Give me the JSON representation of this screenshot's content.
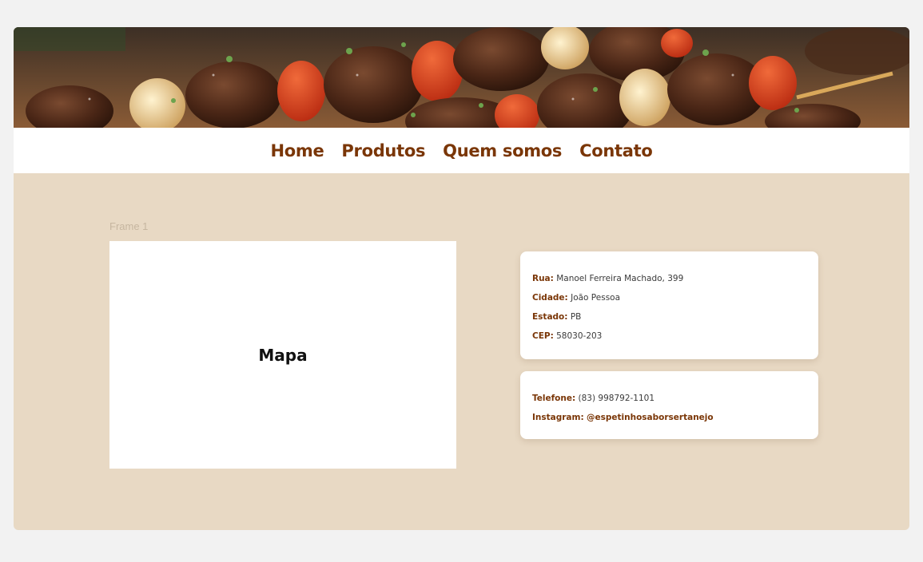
{
  "hero": {
    "image_description_icon": "grilled-skewers-image"
  },
  "nav": {
    "items": [
      {
        "label": "Home"
      },
      {
        "label": "Produtos"
      },
      {
        "label": "Quem somos"
      },
      {
        "label": "Contato"
      }
    ]
  },
  "canvas": {
    "frame_label": "Frame 1"
  },
  "map": {
    "label": "Mapa"
  },
  "address": {
    "street_key": "Rua:",
    "street_value": "Manoel Ferreira Machado, 399",
    "city_key": "Cidade:",
    "city_value": "João Pessoa",
    "state_key": "Estado:",
    "state_value": "PB",
    "zip_key": "CEP:",
    "zip_value": "58030-203"
  },
  "contact": {
    "phone_key": "Telefone:",
    "phone_value": "(83) 998792-1101",
    "instagram_key": "Instagram:",
    "instagram_value": "@espetinhosaborsertanejo"
  },
  "colors": {
    "brand": "#7a3607",
    "background": "#e8d9c4",
    "page": "#f2f2f2"
  }
}
